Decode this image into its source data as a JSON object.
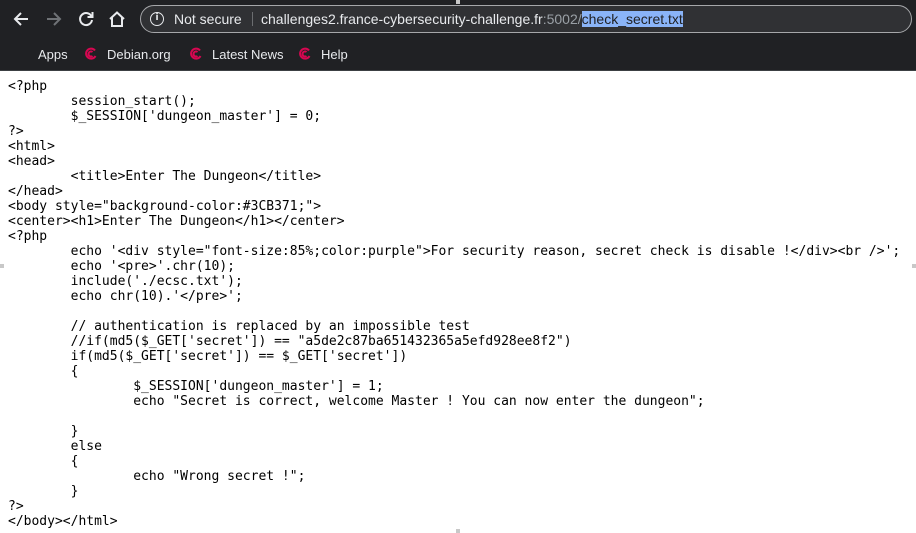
{
  "browser": {
    "security_label": "Not secure",
    "url_host": "challenges2.france-cybersecurity-challenge.fr",
    "url_port": ":5002/",
    "url_path": "check_secret.txt"
  },
  "bookmarks": {
    "apps": "Apps",
    "items": [
      "Debian.org",
      "Latest News",
      "Help"
    ]
  },
  "page": {
    "source_text": "<?php\n        session_start();\n        $_SESSION['dungeon_master'] = 0;\n?>\n<html>\n<head>\n        <title>Enter The Dungeon</title>\n</head>\n<body style=\"background-color:#3CB371;\">\n<center><h1>Enter The Dungeon</h1></center>\n<?php\n        echo '<div style=\"font-size:85%;color:purple\">For security reason, secret check is disable !</div><br />';\n        echo '<pre>'.chr(10);\n        include('./ecsc.txt');\n        echo chr(10).'</pre>';\n\n        // authentication is replaced by an impossible test\n        //if(md5($_GET['secret']) == \"a5de2c87ba651432365a5efd928ee8f2\")\n        if(md5($_GET['secret']) == $_GET['secret'])\n        {\n                $_SESSION['dungeon_master'] = 1;\n                echo \"Secret is correct, welcome Master ! You can now enter the dungeon\";\n\n        }\n        else\n        {\n                echo \"Wrong secret !\";\n        }\n?>\n</body></html>"
  },
  "colors": {
    "toolbar_bg": "#202124",
    "omnibox_bg": "#303134",
    "debian_red": "#d70751",
    "selection": "#8ab4f8"
  }
}
